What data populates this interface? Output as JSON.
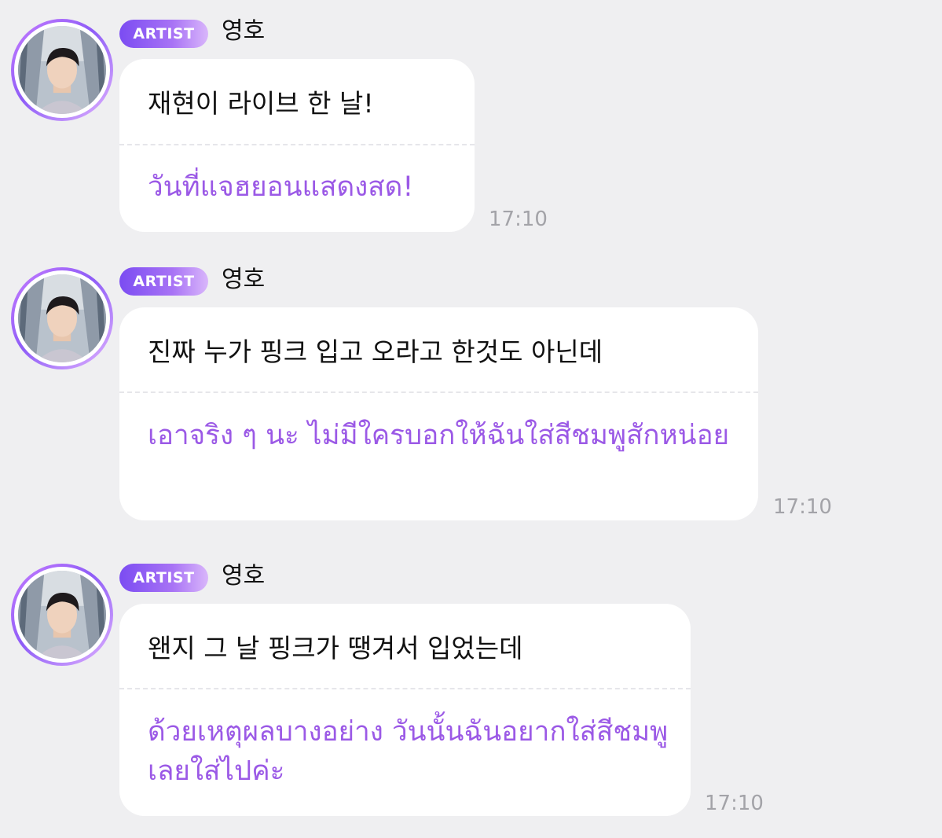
{
  "messages": [
    {
      "badge": "ARTIST",
      "sender": "영호",
      "korean": "재현이 라이브 한 날!",
      "translation": "วันที่แจฮยอนแสดงสด!",
      "time": "17:10"
    },
    {
      "badge": "ARTIST",
      "sender": "영호",
      "korean": "진짜 누가 핑크 입고 오라고 한것도 아닌데",
      "translation": "เอาจริง ๆ นะ ไม่มีใครบอกให้ฉันใส่สีชมพูสักหน่อย",
      "time": "17:10"
    },
    {
      "badge": "ARTIST",
      "sender": "영호",
      "korean": "왠지 그 날 핑크가 땡겨서 입었는데",
      "translation": "ด้วยเหตุผลบางอย่าง วันนั้นฉันอยากใส่สีชมพู เลยใส่ไปค่ะ",
      "time": "17:10"
    }
  ],
  "colors": {
    "background": "#efeff1",
    "bubble": "#ffffff",
    "translation_text": "#9b59e6",
    "badge_start": "#7b4cf2",
    "badge_end": "#d9b6fb",
    "timestamp": "#a3a3a8"
  }
}
